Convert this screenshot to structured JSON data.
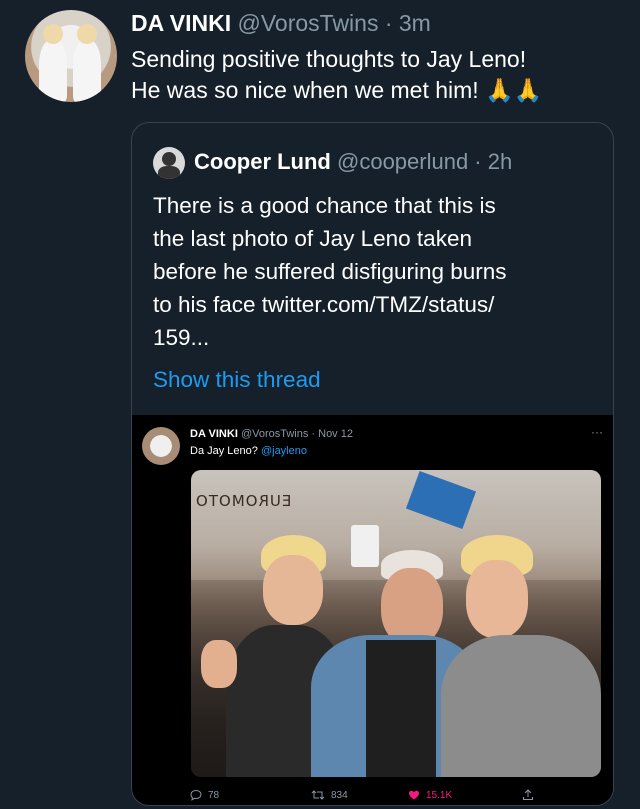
{
  "tweet": {
    "author_name": "DA VINKI",
    "handle_time": "@VorosTwins · 3m",
    "text_line1": "Sending positive thoughts to Jay Leno!",
    "text_line2": "He was so nice when we met him! 🙏🙏"
  },
  "quote": {
    "author_name": "Cooper Lund",
    "handle_time": "@cooperlund · 2h",
    "lines": [
      "There is a good chance that this is",
      "the last photo of Jay Leno taken",
      "before he suffered disfiguring burns",
      "to his face twitter.com/TMZ/status/",
      "159..."
    ],
    "show_thread": "Show this thread"
  },
  "embedded": {
    "author_name": "DA VINKI",
    "handle_time": "@VorosTwins · Nov 12",
    "more": "···",
    "text_prefix": "Da Jay Leno?",
    "mention": "@jayleno",
    "photo_sign": "EUROMOTO",
    "stats": {
      "replies": "78",
      "retweets": "834",
      "likes": "15.1K"
    }
  },
  "colors": {
    "background": "#15202b",
    "accent": "#1d9bf0",
    "muted": "#8899a6",
    "like": "#f91880"
  }
}
